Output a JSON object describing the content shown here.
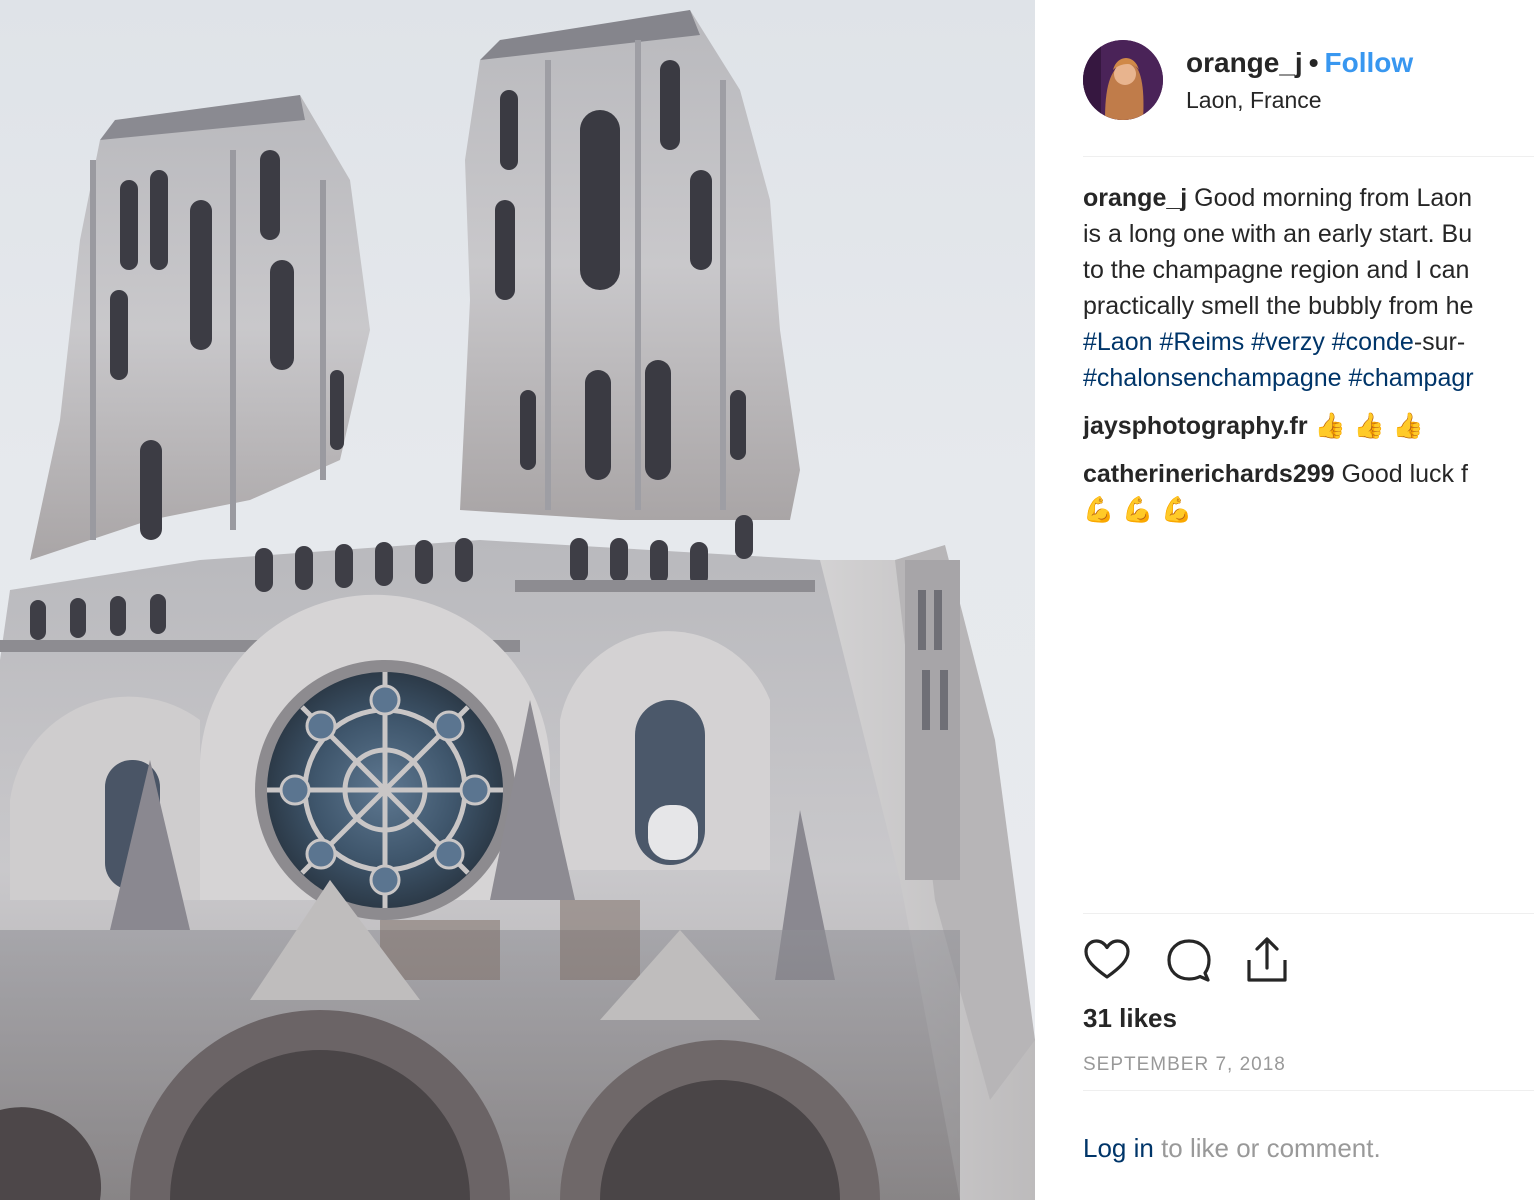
{
  "post": {
    "image": {
      "subject": "cathedral-facade"
    },
    "author": {
      "username": "orange_j",
      "separator": "•",
      "follow_label": "Follow",
      "location": "Laon, France"
    },
    "caption": {
      "username": "orange_j",
      "lines": [
        "Good morning from Laon",
        "is a long one with an early start. Bu",
        "to the champagne region and I can",
        "practically smell the bubbly from he"
      ],
      "hashtags_line1": [
        "#Laon",
        "#Reims",
        "#verzy",
        "#conde"
      ],
      "hashtags_line1_suffix": "-sur-",
      "hashtags_line2": [
        "#chalonsenchampagne",
        "#champagr"
      ]
    },
    "comments": [
      {
        "username": "jaysphotography.fr",
        "text": "",
        "emoji": "👍 👍 👍"
      },
      {
        "username": "catherinerichards299",
        "text": "Good luck f",
        "emoji": "💪 💪 💪"
      }
    ],
    "actions": {
      "like_icon": "heart-icon",
      "comment_icon": "comment-bubble-icon",
      "share_icon": "share-icon"
    },
    "likes": "31 likes",
    "date": "SEPTEMBER 7, 2018",
    "login_prompt": {
      "link": "Log in",
      "text": "to like or comment."
    }
  },
  "colors": {
    "link_blue": "#3897f0",
    "hashtag": "#003569",
    "muted": "#999999",
    "text": "#262626"
  }
}
